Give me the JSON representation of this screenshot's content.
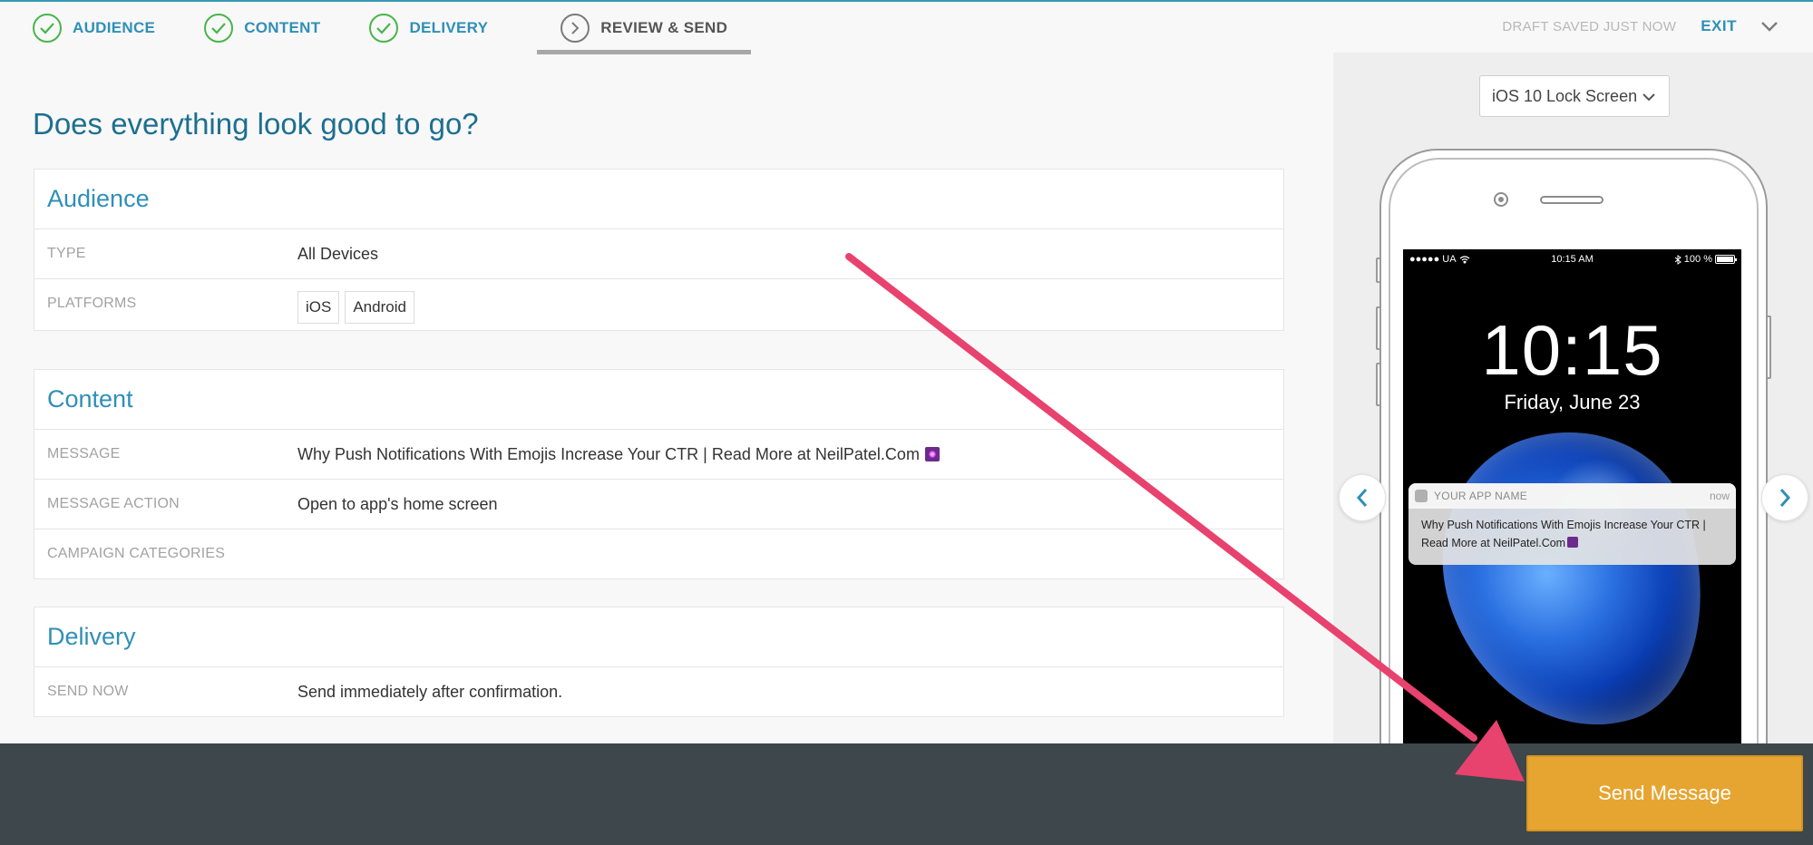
{
  "steps": [
    {
      "label": "AUDIENCE",
      "state": "done"
    },
    {
      "label": "CONTENT",
      "state": "done"
    },
    {
      "label": "DELIVERY",
      "state": "done"
    },
    {
      "label": "REVIEW & SEND",
      "state": "current"
    }
  ],
  "topbar": {
    "draft_status": "DRAFT SAVED JUST NOW",
    "exit_label": "EXIT",
    "chevron_icon": "chevron-down-icon"
  },
  "page_title": "Does everything look good to go?",
  "audience": {
    "heading": "Audience",
    "type_label": "TYPE",
    "type_value": "All Devices",
    "platforms_label": "PLATFORMS",
    "platforms": [
      "iOS",
      "Android"
    ]
  },
  "content": {
    "heading": "Content",
    "message_label": "MESSAGE",
    "message_value": "Why Push Notifications With Emojis Increase Your CTR | Read More at NeilPatel.Com",
    "message_action_label": "MESSAGE ACTION",
    "message_action_value": "Open to app's home screen",
    "campaign_categories_label": "CAMPAIGN CATEGORIES",
    "campaign_categories_value": ""
  },
  "delivery": {
    "heading": "Delivery",
    "send_now_label": "SEND NOW",
    "send_now_value": "Send immediately after confirmation."
  },
  "preview": {
    "device_select": "iOS 10 Lock Screen",
    "status_carrier": "●●●●● UA",
    "status_time": "10:15 AM",
    "status_battery": "100 %",
    "lock_time": "10:15",
    "lock_date": "Friday, June 23",
    "notif_app_name": "YOUR APP NAME",
    "notif_time": "now",
    "notif_body": "Why Push Notifications With Emojis Increase Your CTR | Read More at NeilPatel.Com"
  },
  "footer": {
    "send_button": "Send Message"
  },
  "colors": {
    "accent_blue": "#2f8fb8",
    "check_green": "#48b54a",
    "send_orange": "#e6a531",
    "footer_dark": "#3e474b",
    "annotation_pink": "#e8426e"
  }
}
